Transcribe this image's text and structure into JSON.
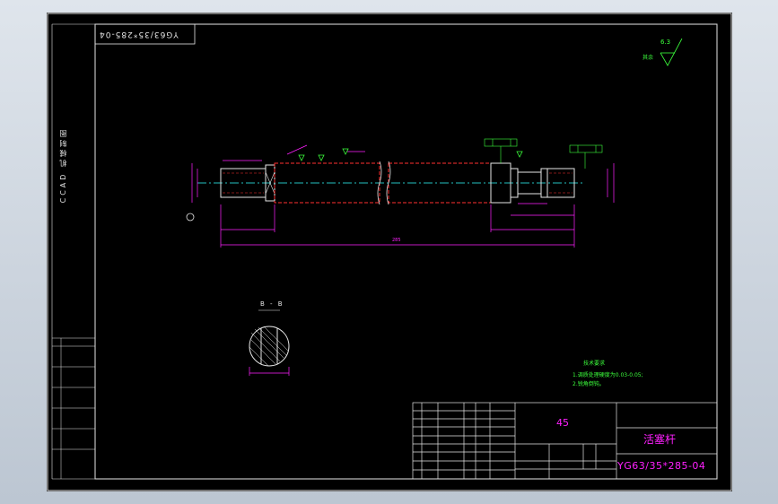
{
  "drawing": {
    "code_box": "YG63/35*285-04",
    "side_vertical_text": "CCAD 机械制图",
    "section_title": "B - B",
    "roughness_value": "6.3",
    "roughness_other": "其余",
    "tech_requirements": {
      "title": "技术要求",
      "line1": "1.调质处理硬度为0.03-0.05;",
      "line2": "2.锐角倒钝。"
    },
    "total_length": "285",
    "title_block": {
      "material": "45",
      "part_name": "活塞杆",
      "drawing_no": "YG63/35*285-04"
    }
  },
  "colors": {
    "frame": "#e6e6e6",
    "dimension": "#ff20ff",
    "outline": "#e6e6e6",
    "tolerance": "#3cff3c",
    "hidden": "#ff3030",
    "centerline": "#30ffff",
    "background": "#000000"
  }
}
